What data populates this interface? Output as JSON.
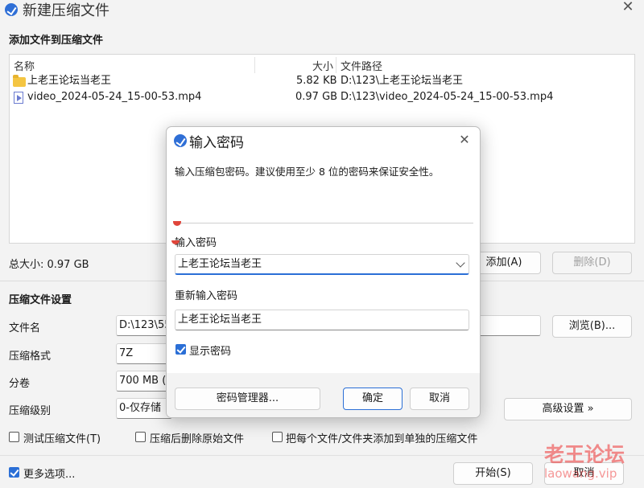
{
  "window": {
    "title": "新建压缩文件"
  },
  "section_add": {
    "title": "添加文件到压缩文件"
  },
  "file_list": {
    "columns": [
      "名称",
      "大小",
      "文件路径"
    ],
    "rows": [
      {
        "name": "上老王论坛当老王",
        "size": "5.82 KB",
        "path": "D:\\123\\上老王论坛当老王",
        "icon": "folder-icon"
      },
      {
        "name": "video_2024-05-24_15-00-53.mp4",
        "size": "0.97 GB",
        "path": "D:\\123\\video_2024-05-24_15-00-53.mp4",
        "icon": "video-file-icon"
      }
    ]
  },
  "total_size": "总大小: 0.97 GB",
  "buttons": {
    "add": "添加(A)",
    "delete": "删除(D)",
    "browse": "浏览(B)...",
    "advanced": "高级设置 »",
    "start": "开始(S)",
    "cancel": "取消"
  },
  "settings": {
    "title": "压缩文件设置",
    "filename_label": "文件名",
    "filename_value": "D:\\123\\55",
    "format_label": "压缩格式",
    "format_value": "7Z",
    "volume_label": "分卷",
    "volume_value": "700 MB (6",
    "level_label": "压缩级别",
    "level_value": "0-仅存储"
  },
  "options": {
    "test": "测试压缩文件(T)",
    "delete_after": "压缩后删除原始文件",
    "separate": "把每个文件/文件夹添加到单独的压缩文件",
    "more": "更多选项..."
  },
  "dialog": {
    "title": "输入密码",
    "description": "输入压缩包密码。建议使用至少 8 位的密码来保证安全性。",
    "password_label": "输入密码",
    "password_value": "上老王论坛当老王",
    "reenter_label": "重新输入密码",
    "reenter_value": "上老王论坛当老王",
    "show_password": "显示密码",
    "manager_button": "密码管理器...",
    "ok_button": "确定",
    "cancel_button": "取消"
  },
  "watermark": {
    "text": "老王论坛",
    "url": "laowang.vip"
  },
  "colors": {
    "accent": "#2b6fd6",
    "strength": "#e0453a",
    "watermark": "#e33333"
  }
}
